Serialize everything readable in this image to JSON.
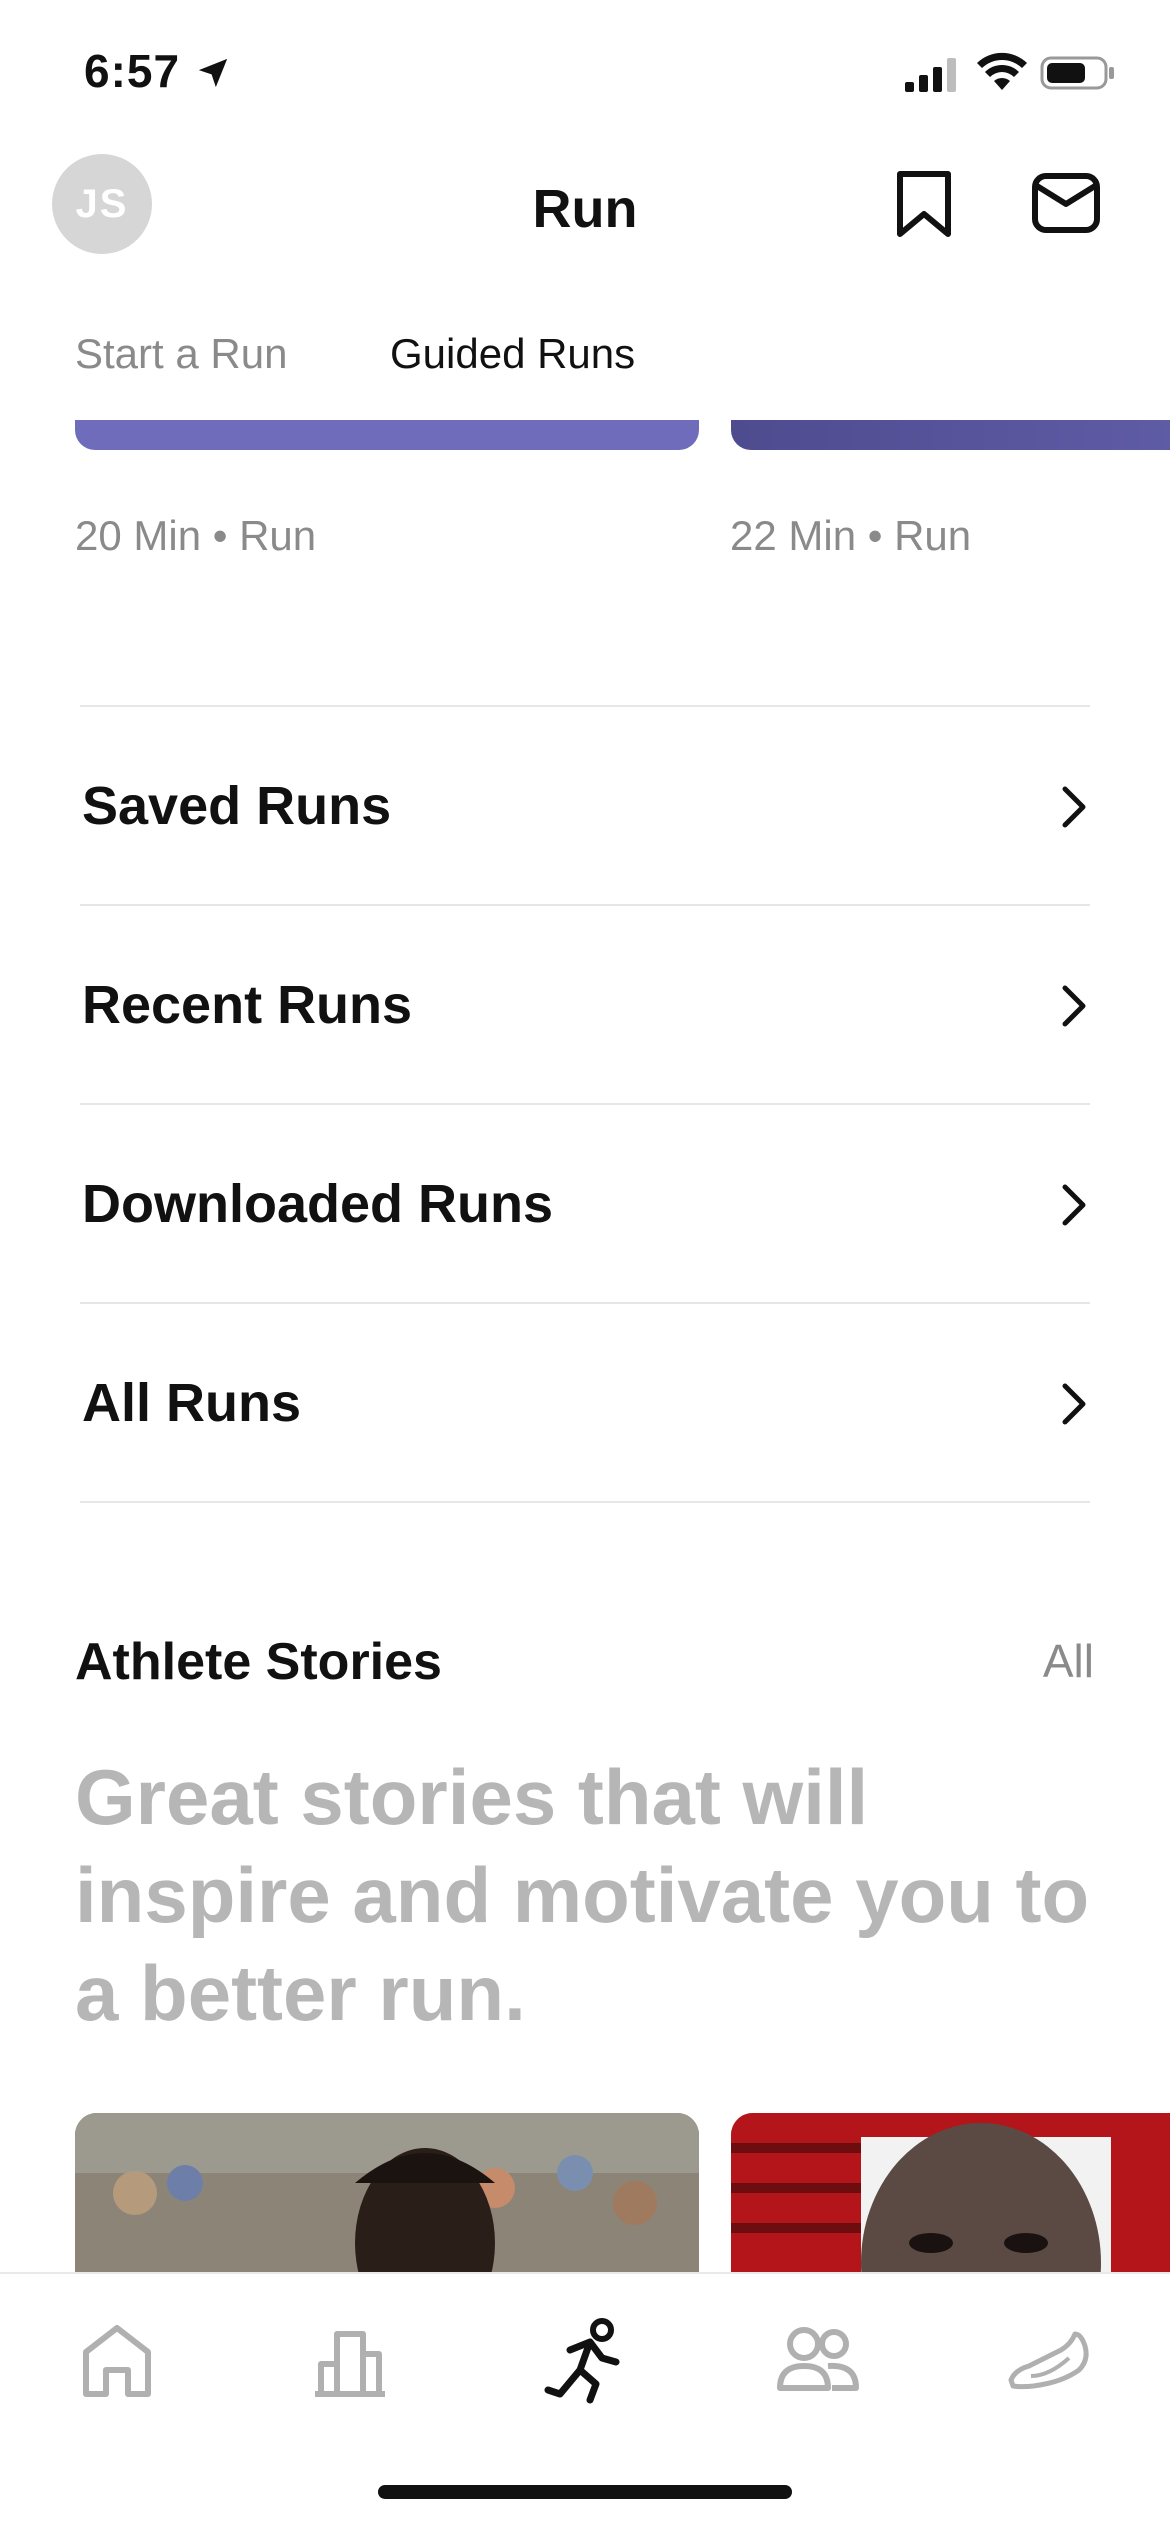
{
  "status_bar": {
    "time": "6:57"
  },
  "header": {
    "avatar_initials": "JS",
    "title": "Run"
  },
  "tabs": [
    {
      "label": "Start a Run",
      "active": false
    },
    {
      "label": "Guided Runs",
      "active": true
    }
  ],
  "cards": [
    {
      "meta": "20 Min • Run"
    },
    {
      "meta": "22 Min • Run"
    }
  ],
  "list": [
    {
      "label": "Saved Runs"
    },
    {
      "label": "Recent Runs"
    },
    {
      "label": "Downloaded Runs"
    },
    {
      "label": "All Runs"
    }
  ],
  "athlete_stories": {
    "title": "Athlete Stories",
    "all_label": "All",
    "description": "Great stories that will inspire and motivate you to a better run."
  },
  "tabbar": [
    {
      "icon": "home-icon",
      "active": false
    },
    {
      "icon": "activity-icon",
      "active": false
    },
    {
      "icon": "run-icon",
      "active": true
    },
    {
      "icon": "club-icon",
      "active": false
    },
    {
      "icon": "shoe-icon",
      "active": false
    }
  ],
  "colors": {
    "accent_card": "#6f6cbc",
    "muted_text": "#8a8a8a",
    "story_red": "#c0161c"
  }
}
